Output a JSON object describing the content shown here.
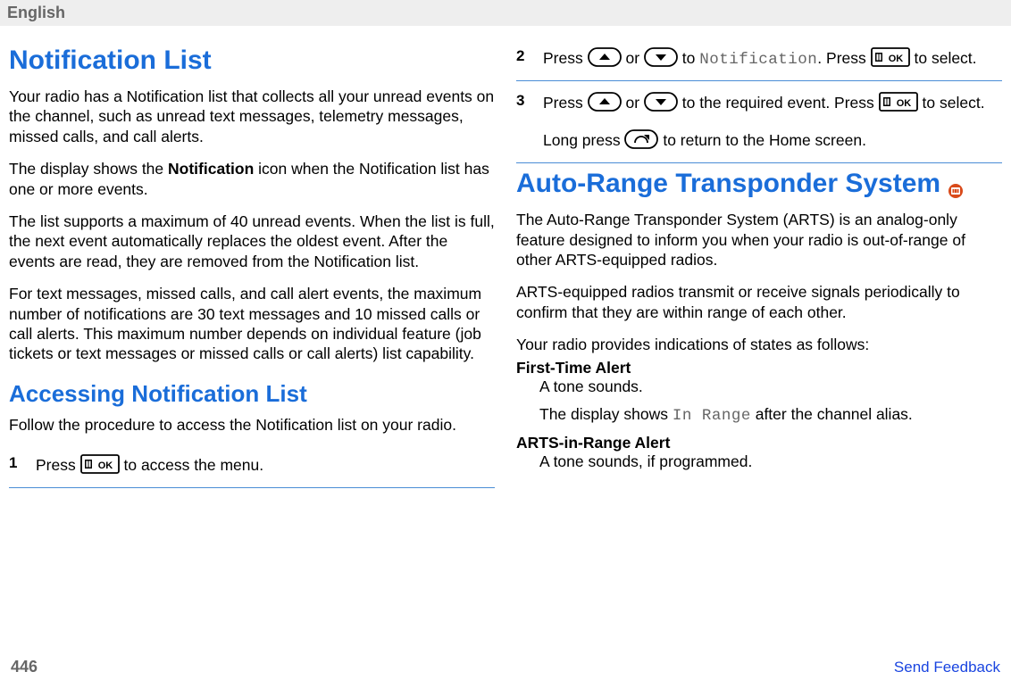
{
  "header": {
    "language": "English"
  },
  "left": {
    "h1": "Notification List",
    "p1": "Your radio has a Notification list that collects all your unread events on the channel, such as unread text messages, telemetry messages, missed calls, and call alerts.",
    "p2_pre": "The display shows the ",
    "p2_bold": "Notification",
    "p2_post": " icon when the Notification list has one or more events.",
    "p3": "The list supports a maximum of 40 unread events. When the list is full, the next event automatically replaces the oldest event. After the events are read, they are removed from the Notification list.",
    "p4": "For text messages, missed calls, and call alert events, the maximum number of notifications are 30 text messages and 10 missed calls or call alerts. This maximum number depends on individual feature (job tickets or text messages or missed calls or call alerts) list capability.",
    "h2": "Accessing Notification List",
    "p5": "Follow the procedure to access the Notification list on your radio.",
    "step1": {
      "num": "1",
      "pre": "Press ",
      "post": " to access the menu."
    }
  },
  "right": {
    "step2": {
      "num": "2",
      "pre": "Press ",
      "mid1": " or ",
      "mid2": " to ",
      "code": "Notification",
      "mid3": ". Press ",
      "post": " to select."
    },
    "step3": {
      "num": "3",
      "l1_pre": "Press ",
      "l1_mid1": " or ",
      "l1_mid2": " to the required event. Press ",
      "l1_post": " to select.",
      "l2_pre": "Long press ",
      "l2_post": " to return to the Home screen."
    },
    "h1": "Auto-Range Transponder System",
    "p1": "The Auto-Range Transponder System (ARTS) is an analog-only feature designed to inform you when your radio is out-of-range of other ARTS-equipped radios.",
    "p2": "ARTS-equipped radios transmit or receive signals periodically to confirm that they are within range of each other.",
    "p3": "Your radio provides indications of states as follows:",
    "dl1_term": "First-Time Alert",
    "dl1_def1": "A tone sounds.",
    "dl1_def2_pre": "The display shows ",
    "dl1_def2_code": "In Range",
    "dl1_def2_post": " after the channel alias.",
    "dl2_term": "ARTS-in-Range Alert",
    "dl2_def": "A tone sounds, if programmed."
  },
  "footer": {
    "page": "446",
    "feedback": "Send Feedback"
  }
}
